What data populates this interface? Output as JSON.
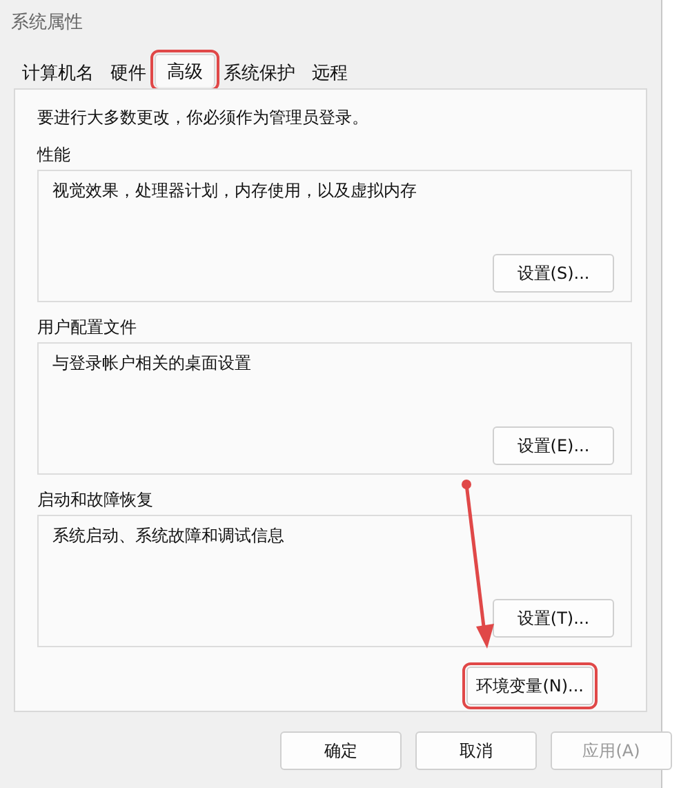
{
  "window": {
    "title": "系统属性"
  },
  "tabs": [
    {
      "label": "计算机名",
      "selected": false,
      "annotated": false
    },
    {
      "label": "硬件",
      "selected": false,
      "annotated": false
    },
    {
      "label": "高级",
      "selected": true,
      "annotated": true
    },
    {
      "label": "系统保护",
      "selected": false,
      "annotated": false
    },
    {
      "label": "远程",
      "selected": false,
      "annotated": false
    }
  ],
  "notice": "要进行大多数更改，你必须作为管理员登录。",
  "groups": [
    {
      "title": "性能",
      "description": "视觉效果，处理器计划，内存使用，以及虚拟内存",
      "button": "设置(S)..."
    },
    {
      "title": "用户配置文件",
      "description": "与登录帐户相关的桌面设置",
      "button": "设置(E)..."
    },
    {
      "title": "启动和故障恢复",
      "description": "系统启动、系统故障和调试信息",
      "button": "设置(T)..."
    }
  ],
  "env_button": {
    "label": "环境变量(N)...",
    "annotated": true
  },
  "buttons": [
    {
      "label": "确定",
      "disabled": false
    },
    {
      "label": "取消",
      "disabled": false
    },
    {
      "label": "应用(A)",
      "disabled": true
    }
  ]
}
